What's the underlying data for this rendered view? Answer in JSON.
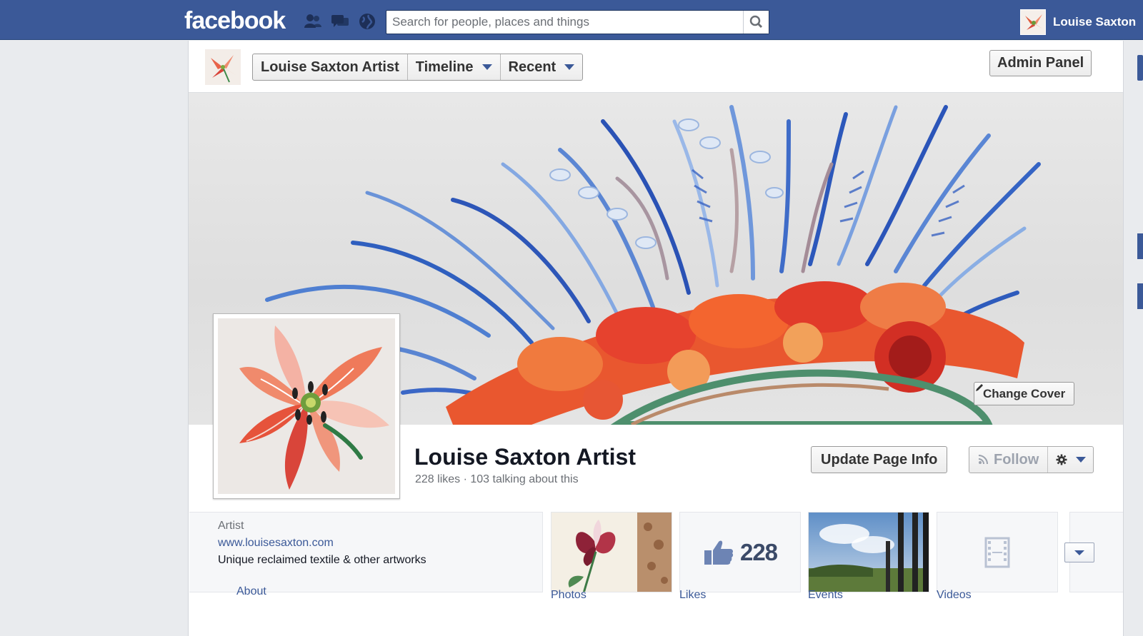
{
  "topbar": {
    "logo": "facebook",
    "search_placeholder": "Search for people, places and things",
    "user_name": "Louise Saxton"
  },
  "page_header": {
    "nav": [
      {
        "label": "Louise Saxton Artist"
      },
      {
        "label": "Timeline"
      },
      {
        "label": "Recent"
      }
    ],
    "admin_label": "Admin Panel"
  },
  "cover": {
    "change_cover_label": "Change Cover"
  },
  "profile": {
    "name": "Louise Saxton Artist",
    "stats": "228 likes · 103 talking about this",
    "update_label": "Update Page Info",
    "follow_label": "Follow"
  },
  "info": {
    "category": "Artist",
    "website": "www.louisesaxton.com",
    "description": "Unique reclaimed textile & other artworks",
    "about_label": "About"
  },
  "apps": [
    {
      "label": "Photos"
    },
    {
      "label": "Likes",
      "count": "228"
    },
    {
      "label": "Events"
    },
    {
      "label": "Videos"
    }
  ],
  "colors": {
    "brand_blue": "#3b5998",
    "link": "#3b5998"
  }
}
